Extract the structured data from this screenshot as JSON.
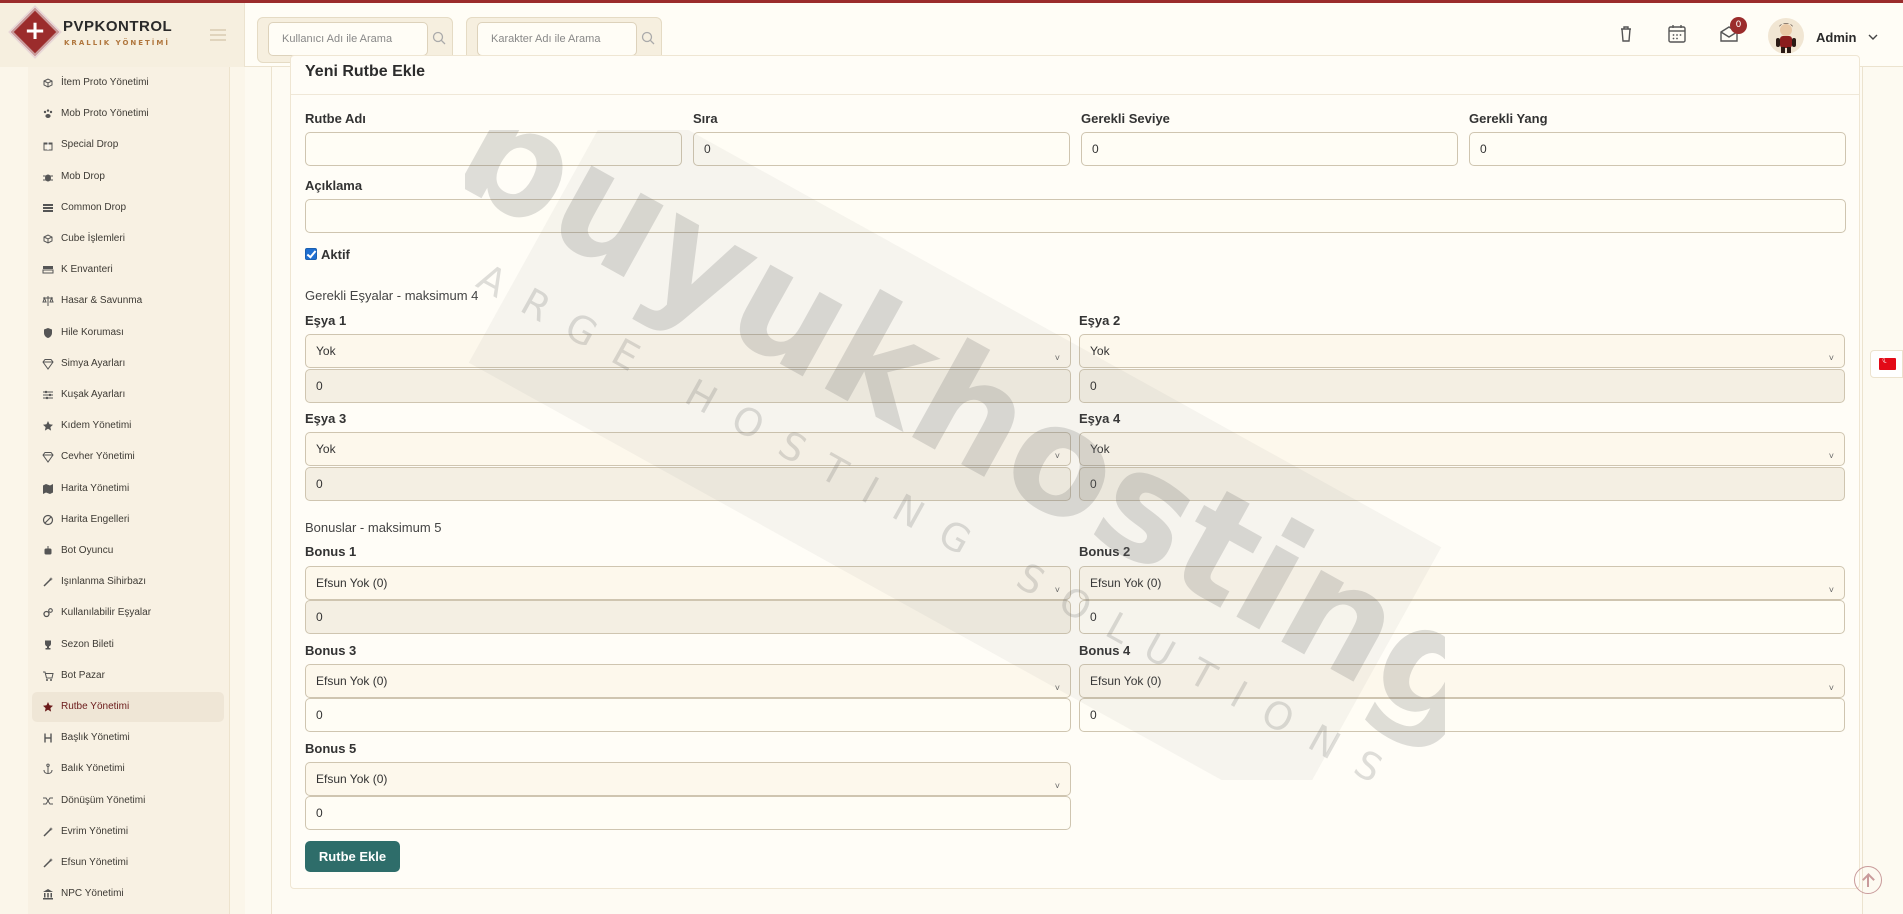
{
  "brand": {
    "name": "PVPKONTROL",
    "subtitle": "KRALLIK YÖNETİMİ"
  },
  "header": {
    "search_user_placeholder": "Kullanıcı Adı ile Arama",
    "search_char_placeholder": "Karakter Adı ile Arama",
    "notification_count": "0",
    "user_name": "Admin",
    "icons": [
      "trash-icon",
      "calendar-icon",
      "mail-icon",
      "chevron-down-icon"
    ]
  },
  "sidebar": {
    "items": [
      {
        "label": "İtem Proto Yönetimi",
        "icon": "box-icon"
      },
      {
        "label": "Mob Proto Yönetimi",
        "icon": "paw-icon"
      },
      {
        "label": "Special Drop",
        "icon": "gift-icon"
      },
      {
        "label": "Mob Drop",
        "icon": "bug-icon"
      },
      {
        "label": "Common Drop",
        "icon": "list-icon"
      },
      {
        "label": "Cube İşlemleri",
        "icon": "cube-icon"
      },
      {
        "label": "K Envanteri",
        "icon": "grid-icon"
      },
      {
        "label": "Hasar & Savunma",
        "icon": "scale-icon"
      },
      {
        "label": "Hile Koruması",
        "icon": "shield-icon"
      },
      {
        "label": "Simya Ayarları",
        "icon": "gem-icon"
      },
      {
        "label": "Kuşak Ayarları",
        "icon": "sliders-icon"
      },
      {
        "label": "Kıdem Yönetimi",
        "icon": "star-icon"
      },
      {
        "label": "Cevher Yönetimi",
        "icon": "gem-icon"
      },
      {
        "label": "Harita Yönetimi",
        "icon": "map-icon"
      },
      {
        "label": "Harita Engelleri",
        "icon": "ban-icon"
      },
      {
        "label": "Bot Oyuncu",
        "icon": "robot-icon"
      },
      {
        "label": "Işınlanma Sihirbazı",
        "icon": "wand-icon"
      },
      {
        "label": "Kullanılabilir Eşyalar",
        "icon": "cogs-icon"
      },
      {
        "label": "Sezon Bileti",
        "icon": "trophy-icon"
      },
      {
        "label": "Bot Pazar",
        "icon": "cart-icon"
      },
      {
        "label": "Rutbe Yönetimi",
        "icon": "star-icon",
        "active": true
      },
      {
        "label": "Başlık Yönetimi",
        "icon": "heading-icon"
      },
      {
        "label": "Balık Yönetimi",
        "icon": "anchor-icon"
      },
      {
        "label": "Dönüşüm Yönetimi",
        "icon": "shuffle-icon"
      },
      {
        "label": "Evrim Yönetimi",
        "icon": "wand-icon"
      },
      {
        "label": "Efsun Yönetimi",
        "icon": "wand-icon"
      },
      {
        "label": "NPC Yönetimi",
        "icon": "building-icon"
      }
    ]
  },
  "form": {
    "title": "Yeni Rutbe Ekle",
    "rank_name_label": "Rutbe Adı",
    "rank_name_value": "",
    "order_label": "Sıra",
    "order_value": "0",
    "req_level_label": "Gerekli Seviye",
    "req_level_value": "0",
    "req_yang_label": "Gerekli Yang",
    "req_yang_value": "0",
    "description_label": "Açıklama",
    "description_value": "",
    "active_label": "Aktif",
    "active_checked": true,
    "items_section": "Gerekli Eşyalar - maksimum 4",
    "items": [
      {
        "label": "Eşya 1",
        "selected": "Yok",
        "count": "0"
      },
      {
        "label": "Eşya 2",
        "selected": "Yok",
        "count": "0"
      },
      {
        "label": "Eşya 3",
        "selected": "Yok",
        "count": "0"
      },
      {
        "label": "Eşya 4",
        "selected": "Yok",
        "count": "0"
      }
    ],
    "bonus_section": "Bonuslar - maksimum 5",
    "bonuses": [
      {
        "label": "Bonus 1",
        "selected": "Efsun Yok (0)",
        "value": "0"
      },
      {
        "label": "Bonus 2",
        "selected": "Efsun Yok (0)",
        "value": "0"
      },
      {
        "label": "Bonus 3",
        "selected": "Efsun Yok (0)",
        "value": "0"
      },
      {
        "label": "Bonus 4",
        "selected": "Efsun Yok (0)",
        "value": "0"
      },
      {
        "label": "Bonus 5",
        "selected": "Efsun Yok (0)",
        "value": "0"
      }
    ],
    "submit_label": "Rutbe Ekle"
  },
  "watermark": {
    "brand": "buyukhosting",
    "tagline": "LARGE HOSTING SOLUTIONS"
  },
  "colors": {
    "accent": "#9b2c2c",
    "button": "#2e6d6a",
    "background": "#fdfaf1"
  }
}
